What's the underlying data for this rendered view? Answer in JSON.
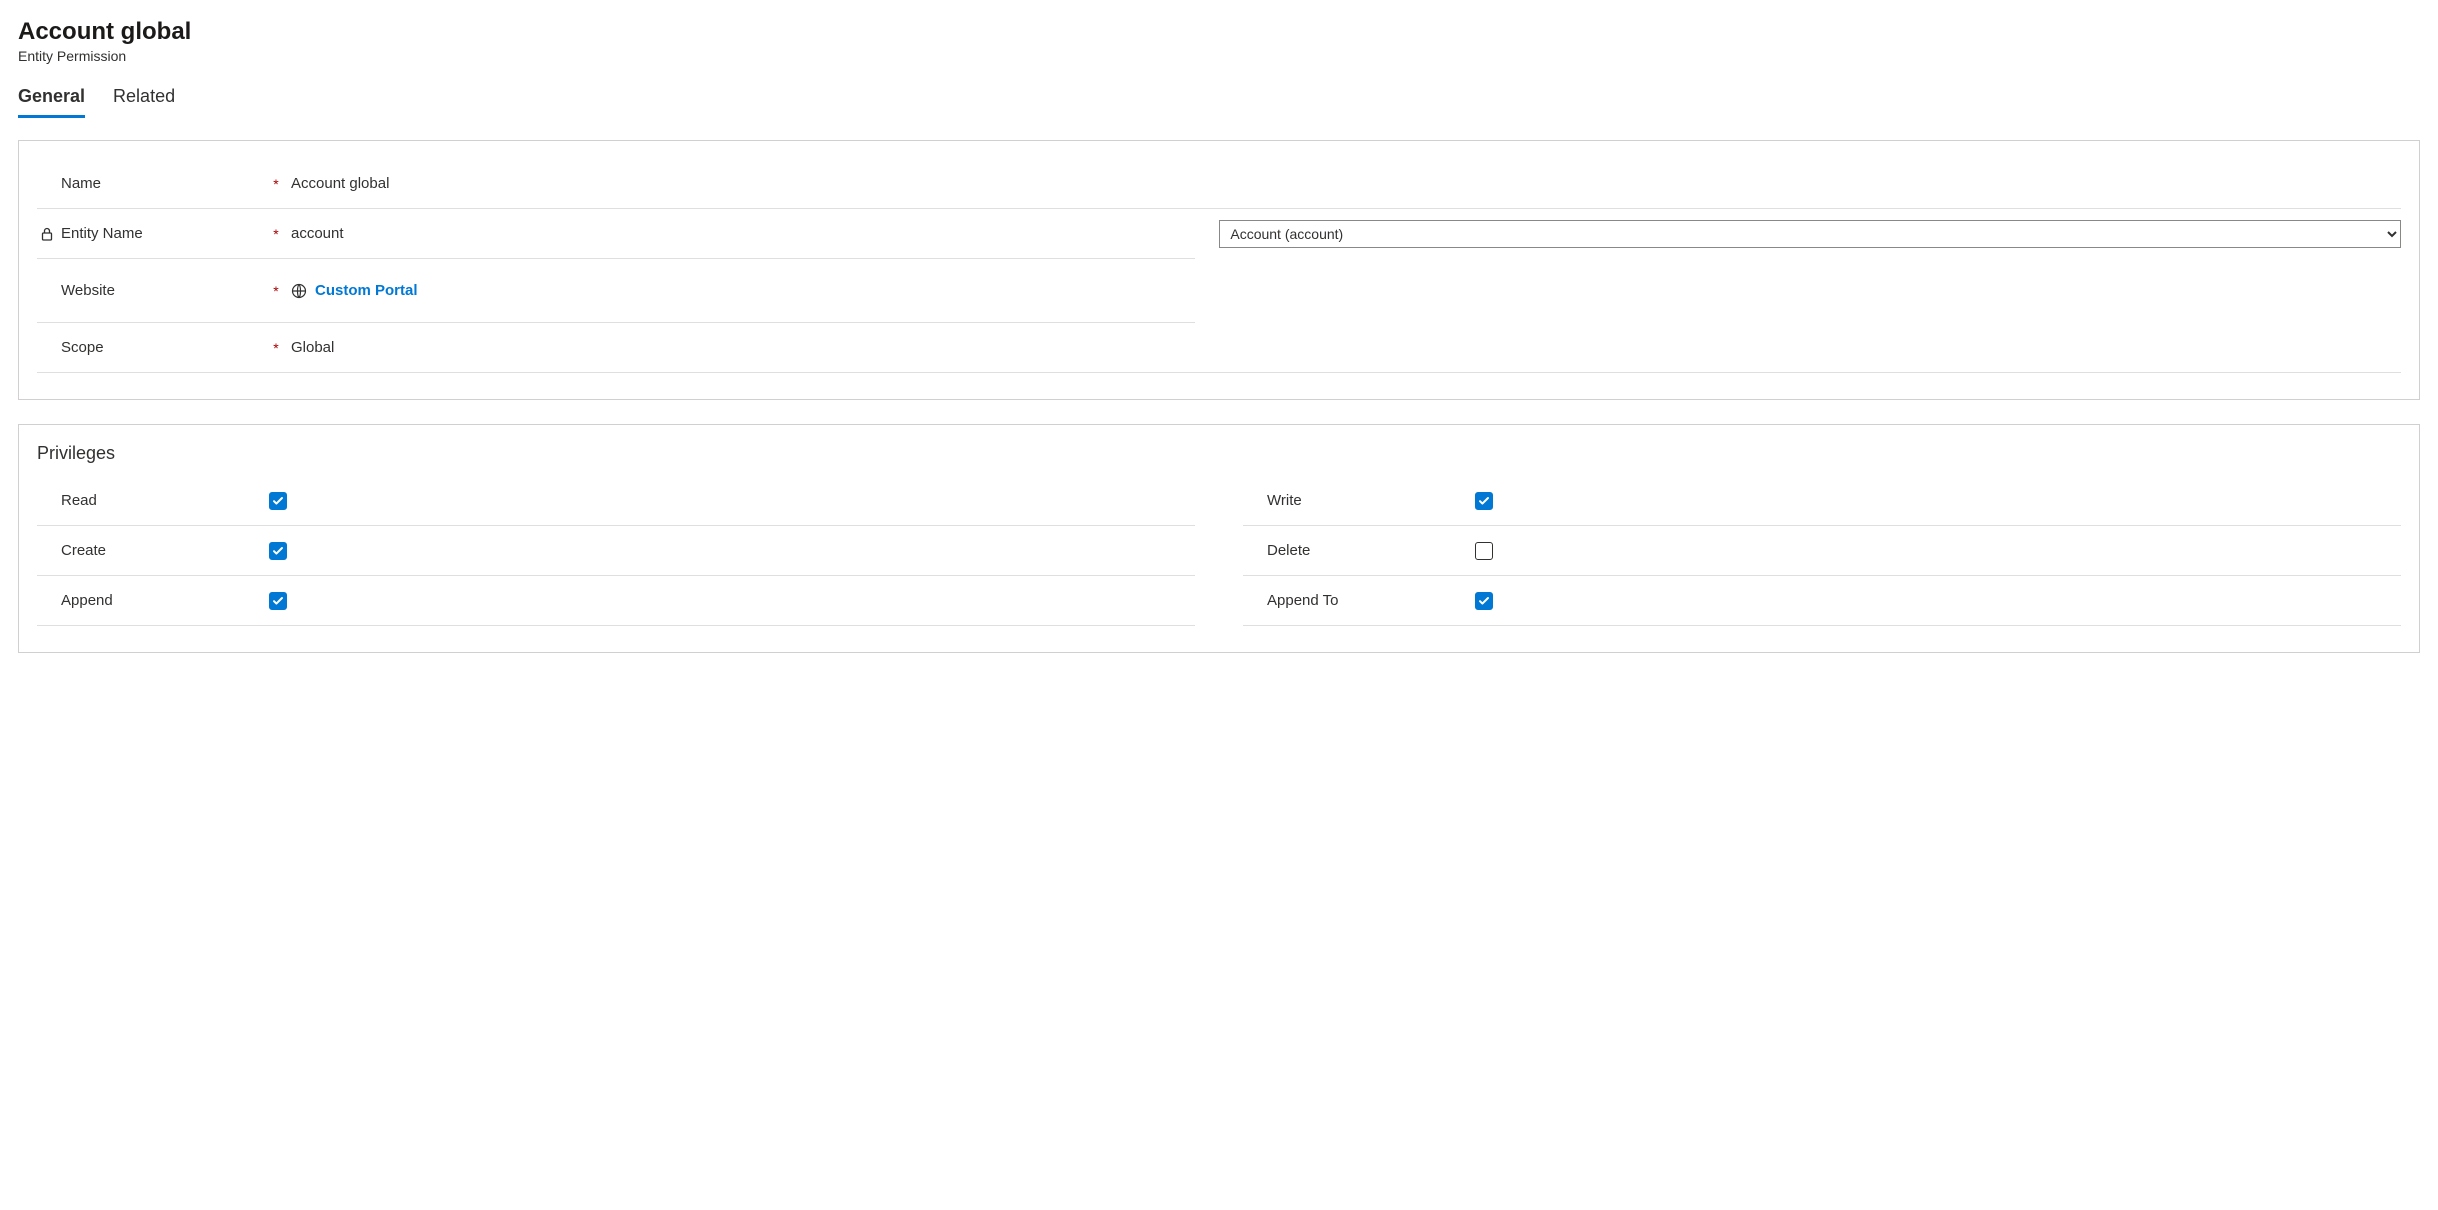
{
  "header": {
    "title": "Account global",
    "subtitle": "Entity Permission"
  },
  "tabs": {
    "general": "General",
    "related": "Related"
  },
  "fields": {
    "name": {
      "label": "Name",
      "value": "Account global"
    },
    "entityName": {
      "label": "Entity Name",
      "value": "account"
    },
    "entitySelect": {
      "value": "Account (account)"
    },
    "website": {
      "label": "Website",
      "value": "Custom Portal"
    },
    "scope": {
      "label": "Scope",
      "value": "Global"
    }
  },
  "privileges": {
    "title": "Privileges",
    "read": {
      "label": "Read",
      "checked": true
    },
    "write": {
      "label": "Write",
      "checked": true
    },
    "create": {
      "label": "Create",
      "checked": true
    },
    "delete": {
      "label": "Delete",
      "checked": false
    },
    "append": {
      "label": "Append",
      "checked": true
    },
    "appendTo": {
      "label": "Append To",
      "checked": true
    }
  }
}
